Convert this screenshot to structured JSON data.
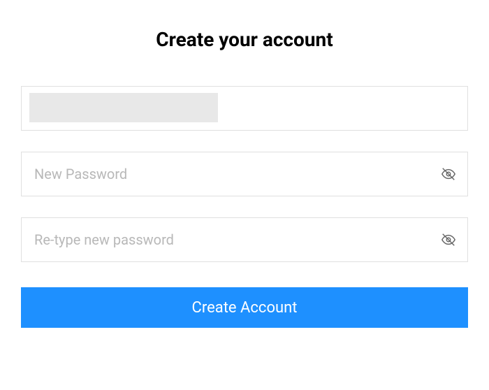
{
  "header": {
    "title": "Create your account"
  },
  "form": {
    "username": {
      "value": "",
      "placeholder": ""
    },
    "password": {
      "value": "",
      "placeholder": "New Password"
    },
    "confirm_password": {
      "value": "",
      "placeholder": "Re-type new password"
    },
    "submit_label": "Create Account"
  },
  "colors": {
    "primary": "#1e90ff",
    "border": "#e0e0e0",
    "placeholder": "#b8b8b8",
    "redacted": "#e8e8e8"
  }
}
